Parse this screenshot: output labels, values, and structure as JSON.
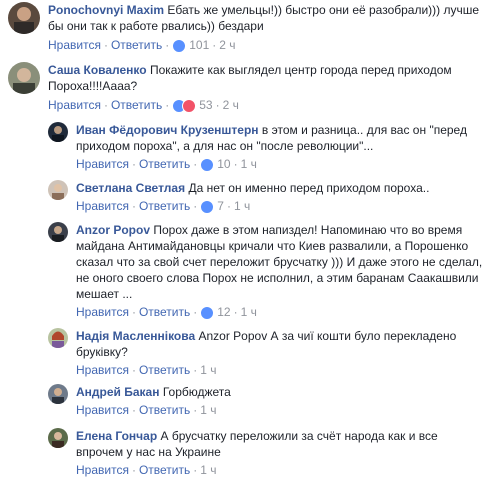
{
  "comments": [
    {
      "author": "Ponochovnyi Maxim",
      "text": "Ебать же умельцы!)) быстро они её разобрали))) лучше бы они так к работе рвались)) бездари",
      "actions": {
        "like": "Нравится",
        "reply": "Ответить",
        "count": "101",
        "time": "2 ч"
      },
      "reactions": [
        "like"
      ]
    },
    {
      "author": "Саша Коваленко",
      "text": "Покажите как выглядел центр города перед приходом Пороха!!!!Аааа?",
      "actions": {
        "like": "Нравится",
        "reply": "Ответить",
        "count": "53",
        "time": "2 ч"
      },
      "reactions": [
        "like",
        "love"
      ]
    }
  ],
  "replies": [
    {
      "author": "Иван Фёдорович Крузенштерн",
      "text": "в этом и разница.. для вас он \"перед приходом пороха\", а для нас он \"после революции\"...",
      "actions": {
        "like": "Нравится",
        "reply": "Ответить",
        "count": "10",
        "time": "1 ч"
      },
      "reactions": [
        "like"
      ]
    },
    {
      "author": "Светлана Светлая",
      "text": "Да нет он именно перед приходом пороха..",
      "actions": {
        "like": "Нравится",
        "reply": "Ответить",
        "count": "7",
        "time": "1 ч"
      },
      "reactions": [
        "like"
      ]
    },
    {
      "author": "Anzor Popov",
      "text": "Порох даже в этом напиздел! Напоминаю что во время майдана Антимайдановцы кричали что Киев развалили, а Порошенко сказал что за свой счет переложит брусчатку ))) И даже этого не сделал, не оного своего слова Порох не исполнил, а этим баранам Саакашвили мешает ...",
      "actions": {
        "like": "Нравится",
        "reply": "Ответить",
        "count": "12",
        "time": "1 ч"
      },
      "reactions": [
        "like"
      ]
    },
    {
      "author": "Надія Масленнікова",
      "text": "Anzor Popov А за чиї кошти було перекладено бруківку?",
      "actions": {
        "like": "Нравится",
        "reply": "Ответить",
        "count": "",
        "time": "1 ч"
      },
      "reactions": []
    },
    {
      "author": "Андрей Бакан",
      "text": "Горбюджета",
      "actions": {
        "like": "Нравится",
        "reply": "Ответить",
        "count": "",
        "time": "1 ч"
      },
      "reactions": []
    },
    {
      "author": "Елена Гончар",
      "text": "А брусчатку переложили за счёт народа как и все впрочем у нас на Украине",
      "actions": {
        "like": "Нравится",
        "reply": "Ответить",
        "count": "",
        "time": "1 ч"
      },
      "reactions": []
    }
  ],
  "colors": {
    "link": "#385898",
    "action": "#4267b2",
    "meta": "#90949c",
    "like": "#5890ff",
    "love": "#f25268"
  }
}
